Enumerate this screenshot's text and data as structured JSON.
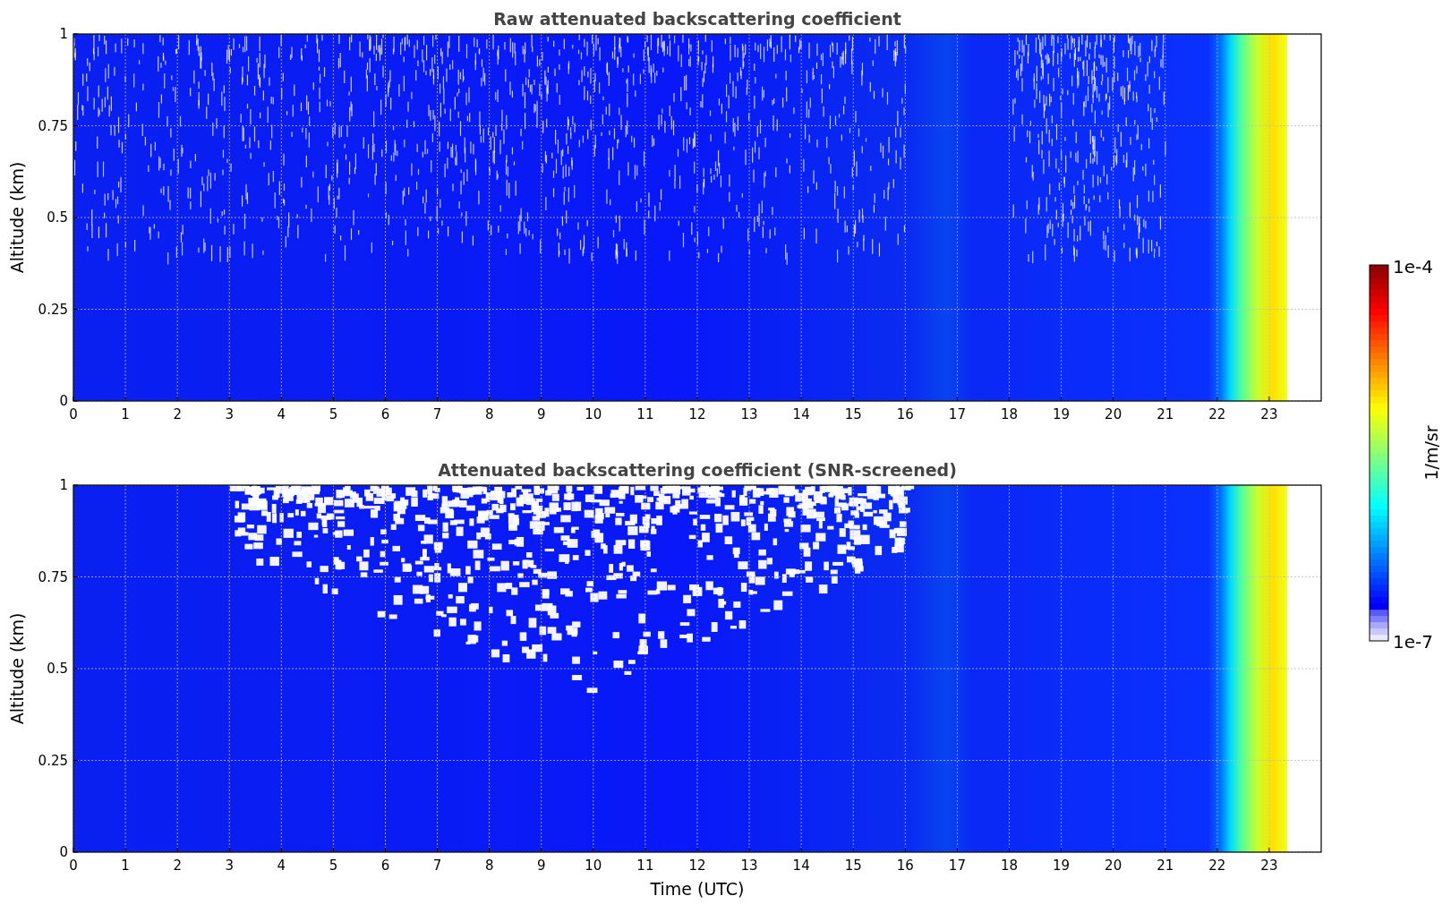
{
  "panels": [
    {
      "kind": "raw",
      "title": "Raw attenuated backscattering coefficient",
      "ylabel": "Altitude (km)",
      "yticks": [
        "1",
        "0.75",
        "0.5",
        "0.25",
        "0"
      ],
      "xticks": [
        "0",
        "1",
        "2",
        "3",
        "4",
        "5",
        "6",
        "7",
        "8",
        "9",
        "10",
        "11",
        "12",
        "13",
        "14",
        "15",
        "16",
        "17",
        "18",
        "19",
        "20",
        "21",
        "22",
        "23"
      ]
    },
    {
      "kind": "screened",
      "title": "Attenuated backscattering coefficient (SNR-screened)",
      "ylabel": "Altitude (km)",
      "xlabel": "Time (UTC)",
      "yticks": [
        "1",
        "0.75",
        "0.5",
        "0.25",
        "0"
      ],
      "xticks": [
        "0",
        "1",
        "2",
        "3",
        "4",
        "5",
        "6",
        "7",
        "8",
        "9",
        "10",
        "11",
        "12",
        "13",
        "14",
        "15",
        "16",
        "17",
        "18",
        "19",
        "20",
        "21",
        "22",
        "23"
      ]
    }
  ],
  "colorbar": {
    "label": "1/m/sr",
    "max_label": "1e-4",
    "min_label": "1e-7"
  }
}
